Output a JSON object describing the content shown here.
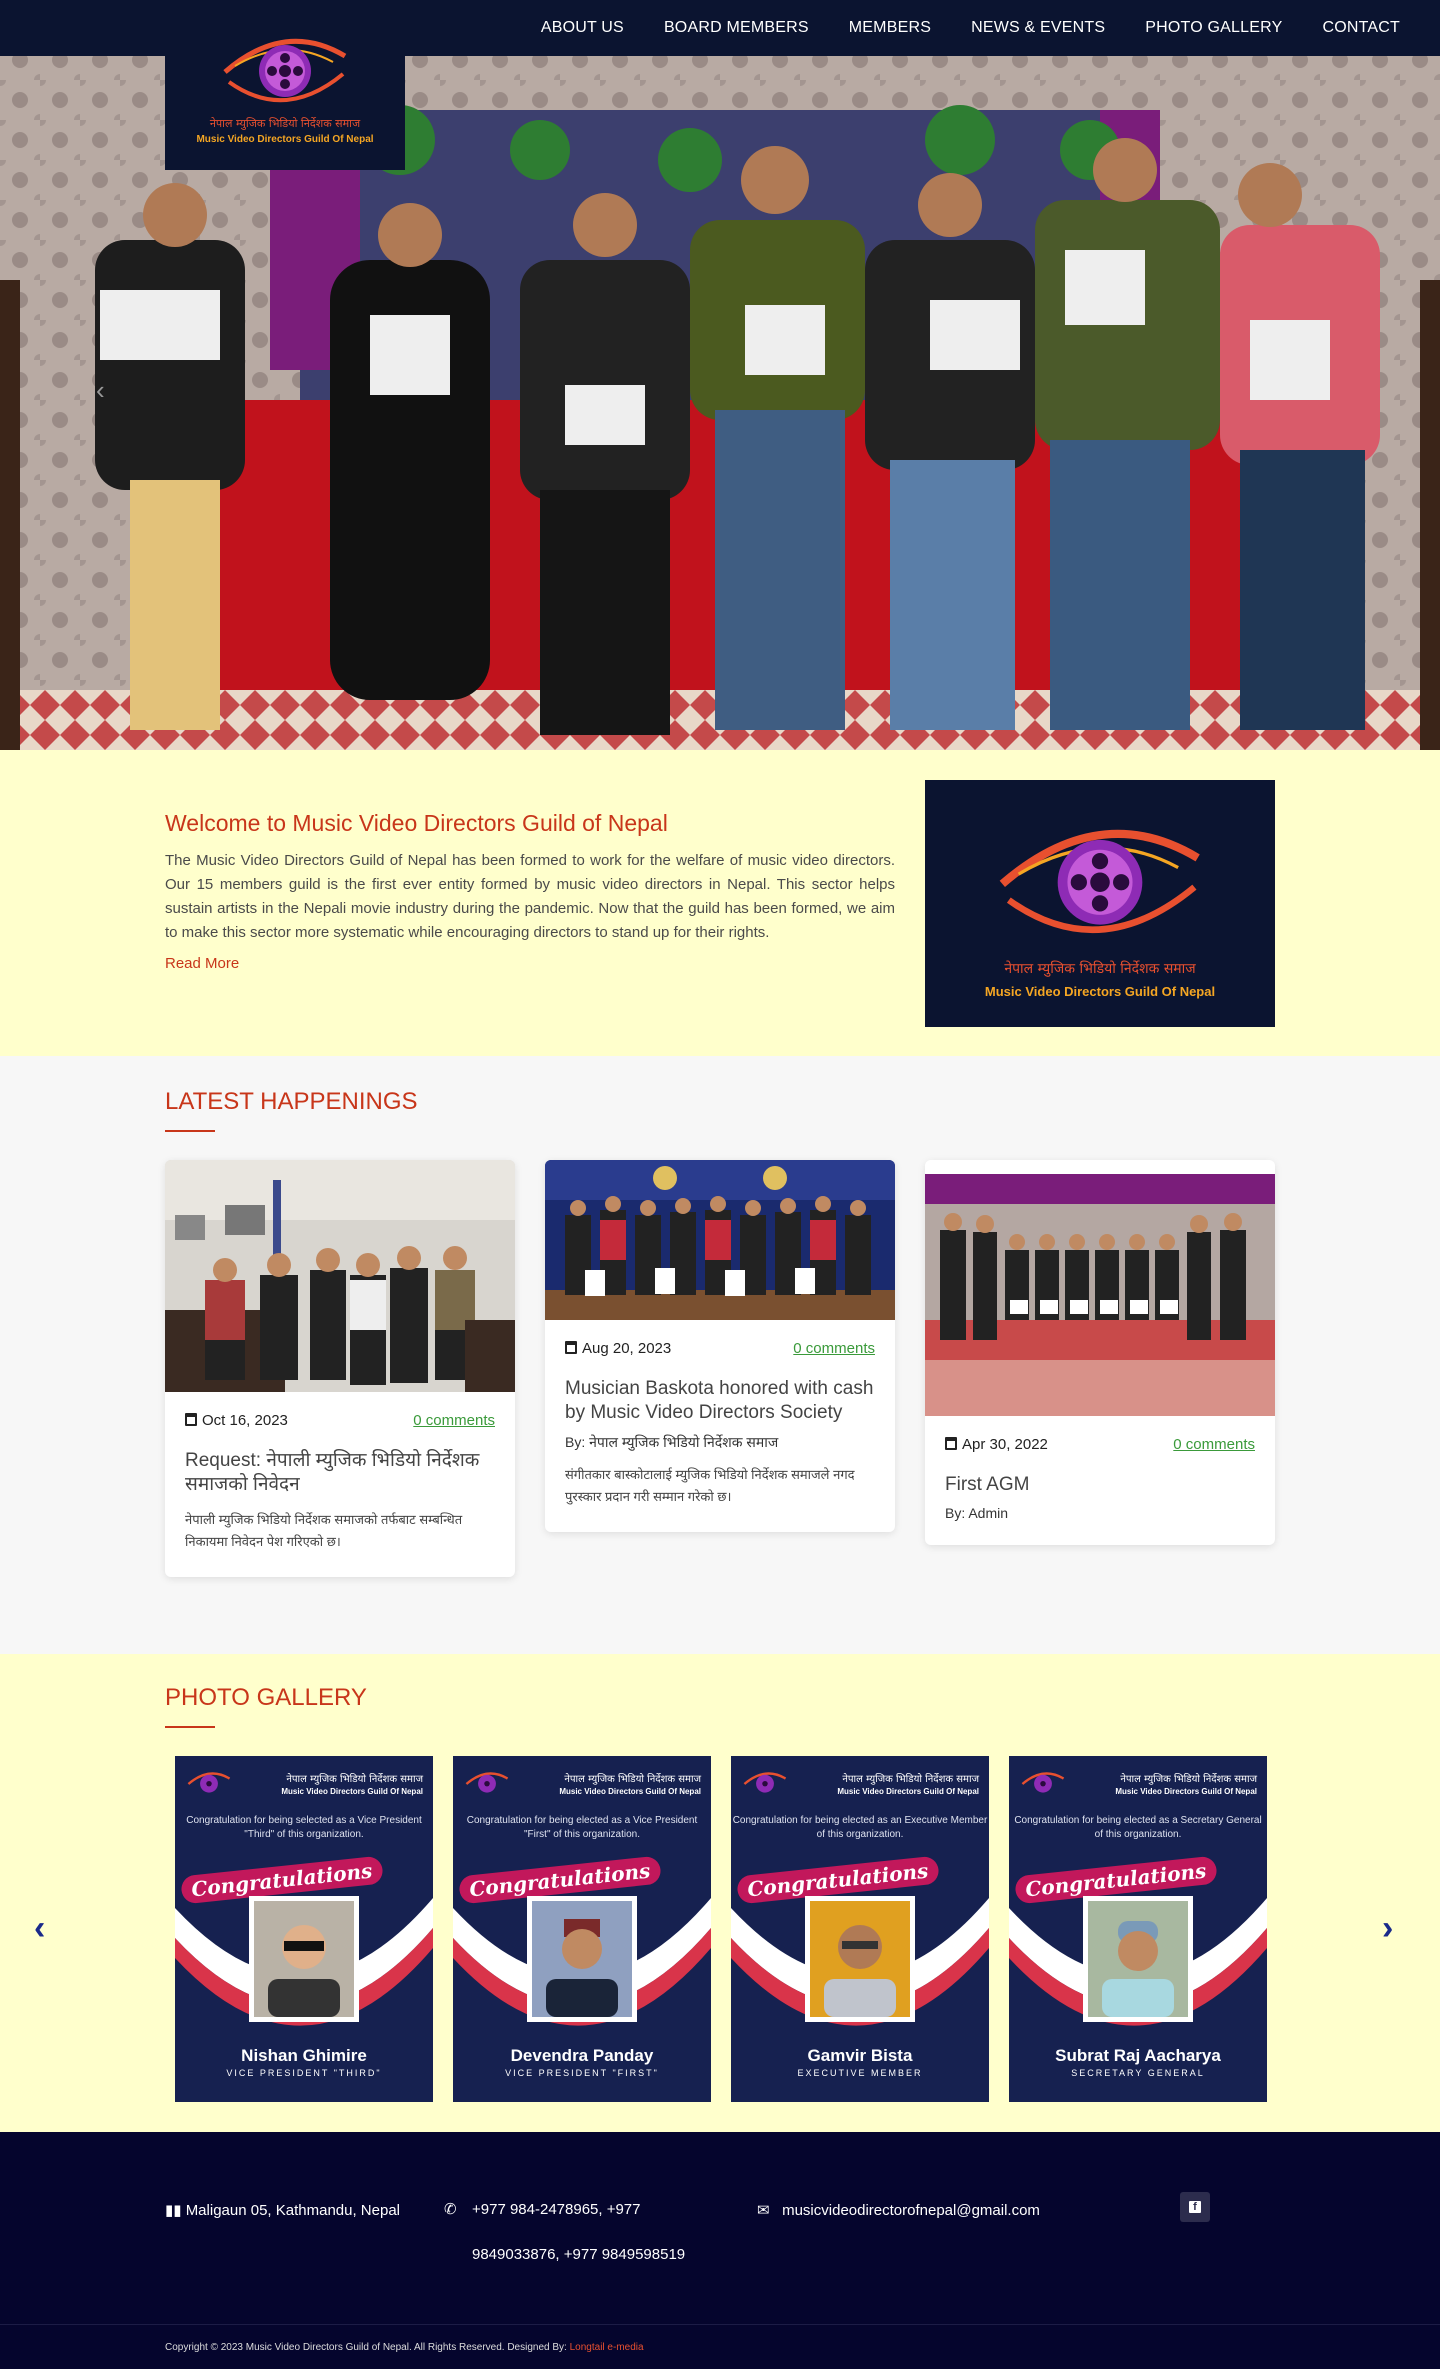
{
  "nav": {
    "items": [
      "ABOUT US",
      "BOARD MEMBERS",
      "MEMBERS",
      "NEWS & EVENTS",
      "PHOTO GALLERY",
      "CONTACT"
    ]
  },
  "logo": {
    "nepali": "नेपाल म्युजिक भिडियो निर्देशक समाज",
    "english": "Music Video Directors Guild Of Nepal"
  },
  "hero": {
    "prev_icon": "chevron-left-icon"
  },
  "welcome": {
    "title": "Welcome to Music Video Directors Guild of Nepal",
    "body": "The Music Video Directors Guild of Nepal has been formed to work for the welfare of music video directors. Our 15 members guild is the first ever entity formed by music video directors in Nepal. This sector helps sustain artists in the Nepali movie industry during the pandemic. Now that the guild has been formed, we aim to make this sector more systematic while encouraging directors to stand up for their rights.",
    "read_more": "Read More"
  },
  "happenings": {
    "title": "LATEST HAPPENINGS",
    "cards": [
      {
        "date": "Oct 16, 2023",
        "comments": "0 comments",
        "title": "Request: नेपाली म्युजिक भिडियो निर्देशक समाजको निवेदन",
        "by": "",
        "excerpt": "नेपाली म्युजिक भिडियो निर्देशक समाजको तर्फबाट सम्बन्धित निकायमा निवेदन पेश गरिएको छ।"
      },
      {
        "date": "Aug 20, 2023",
        "comments": "0 comments",
        "title": "Musician Baskota honored with cash by Music Video Directors Society",
        "by": "By: नेपाल म्युजिक भिडियो निर्देशक समाज",
        "excerpt": "संगीतकार बास्कोटालाई म्युजिक भिडियो निर्देशक समाजले नगद पुरस्कार प्रदान गरी सम्मान गरेको छ।"
      },
      {
        "date": "Apr 30, 2022",
        "comments": "0 comments",
        "title": "First AGM",
        "by": "By: Admin",
        "excerpt": ""
      }
    ]
  },
  "gallery": {
    "title": "PHOTO GALLERY",
    "posters": [
      {
        "message": "Congratulation for being selected as a Vice President \"Third\" of this organization.",
        "congrats": "Congratulations",
        "name": "Nishan Ghimire",
        "role": "VICE PRESIDENT \"THIRD\""
      },
      {
        "message": "Congratulation for being elected as a Vice President \"First\" of this organization.",
        "congrats": "Congratulations",
        "name": "Devendra Panday",
        "role": "VICE PRESIDENT \"FIRST\""
      },
      {
        "message": "Congratulation for being elected as an Executive Member of this organization.",
        "congrats": "Congratulations",
        "name": "Gamvir Bista",
        "role": "EXECUTIVE MEMBER"
      },
      {
        "message": "Congratulation for being elected as a Secretary General of this organization.",
        "congrats": "Congratulations",
        "name": "Subrat Raj Aacharya",
        "role": "SECRETARY GENERAL"
      }
    ]
  },
  "footer": {
    "address": "Maligaun 05, Kathmandu, Nepal",
    "phone": "+977 984-2478965, +977 9849033876, +977 9849598519",
    "email": "musicvideodirectorofnepal@gmail.com",
    "copyright": "Copyright © 2023 Music Video Directors Guild of Nepal. All Rights Reserved. Designed By:",
    "designer": "Longtail e-media"
  },
  "colors": {
    "navy": "#0b1430",
    "accent": "#c8361a",
    "cream": "#ffffcc",
    "footer": "#05052d",
    "link_green": "#3a9a3a"
  }
}
